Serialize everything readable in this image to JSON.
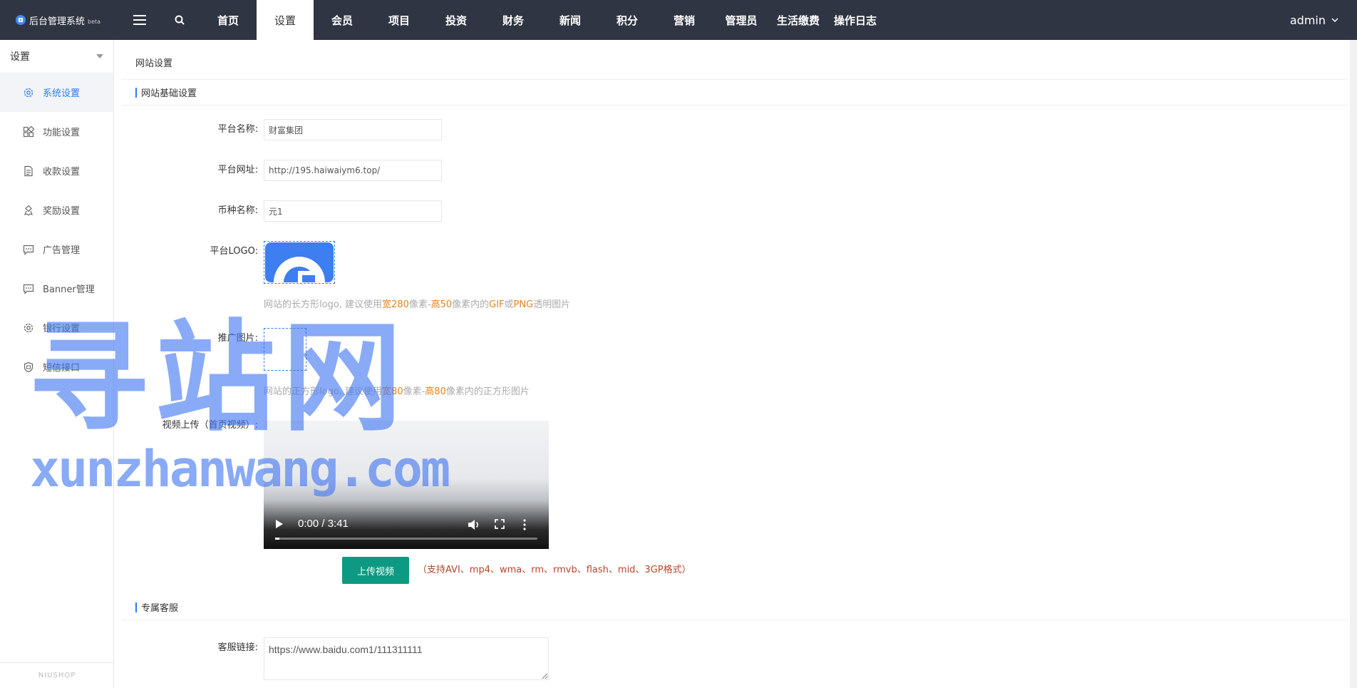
{
  "brand": {
    "title": "后台管理系统",
    "sub": "beta"
  },
  "nav": {
    "items": [
      "首页",
      "设置",
      "会员",
      "项目",
      "投资",
      "财务",
      "新闻",
      "积分",
      "营销",
      "管理员",
      "生活缴费",
      "操作日志"
    ],
    "active": "设置"
  },
  "user": {
    "name": "admin"
  },
  "sidebar": {
    "header": "设置",
    "items": [
      {
        "label": "系统设置",
        "icon": "gear-icon",
        "active": true
      },
      {
        "label": "功能设置",
        "icon": "function-icon"
      },
      {
        "label": "收款设置",
        "icon": "document-icon"
      },
      {
        "label": "奖励设置",
        "icon": "award-icon"
      },
      {
        "label": "广告管理",
        "icon": "message-icon"
      },
      {
        "label": "Banner管理",
        "icon": "message-icon"
      },
      {
        "label": "银行设置",
        "icon": "gear-icon"
      },
      {
        "label": "短信接口",
        "icon": "sms-icon"
      }
    ],
    "footer": "NIUSHOP"
  },
  "main": {
    "title": "网站设置",
    "section_basic": "网站基础设置",
    "fields": {
      "platform_name": {
        "label": "平台名称:",
        "value": "财富集团"
      },
      "platform_url": {
        "label": "平台网址:",
        "value": "http://195.haiwaiym6.top/"
      },
      "currency": {
        "label": "币种名称:",
        "value": "元1"
      },
      "logo": {
        "label": "平台LOGO:"
      },
      "promo": {
        "label": "推广图片:"
      },
      "video": {
        "label": "视频上传（首页视频）:"
      }
    },
    "logo_hint": {
      "p1": "网站的长方形logo, 建议使用",
      "h1": "宽280",
      "p2": "像素-",
      "h2": "高50",
      "p3": "像素内的",
      "h3": "GIF",
      "p4": "或",
      "h4": "PNG",
      "p5": "透明图片"
    },
    "promo_hint": {
      "p1": "网站的正方形logo, 建议使用",
      "h1": "宽80",
      "p2": "像素-",
      "h2": "高80",
      "p3": "像素内的正方形图片"
    },
    "video_player": {
      "time": "0:00 / 3:41"
    },
    "upload": {
      "button": "上传视频",
      "note": "（支持AVI、mp4、wma、rm、rmvb、flash、mid、3GP格式）"
    },
    "section_service": "专属客服",
    "service": {
      "label": "客服链接:",
      "value": "https://www.baidu.com1/111311111"
    }
  },
  "watermark": {
    "cn": "寻站网",
    "en": "xunzhanwang.com"
  },
  "colors": {
    "topbar": "#2f3542",
    "accent": "#2d7cf4",
    "button": "#0e9a82",
    "hint_highlight": "#e8811a"
  }
}
